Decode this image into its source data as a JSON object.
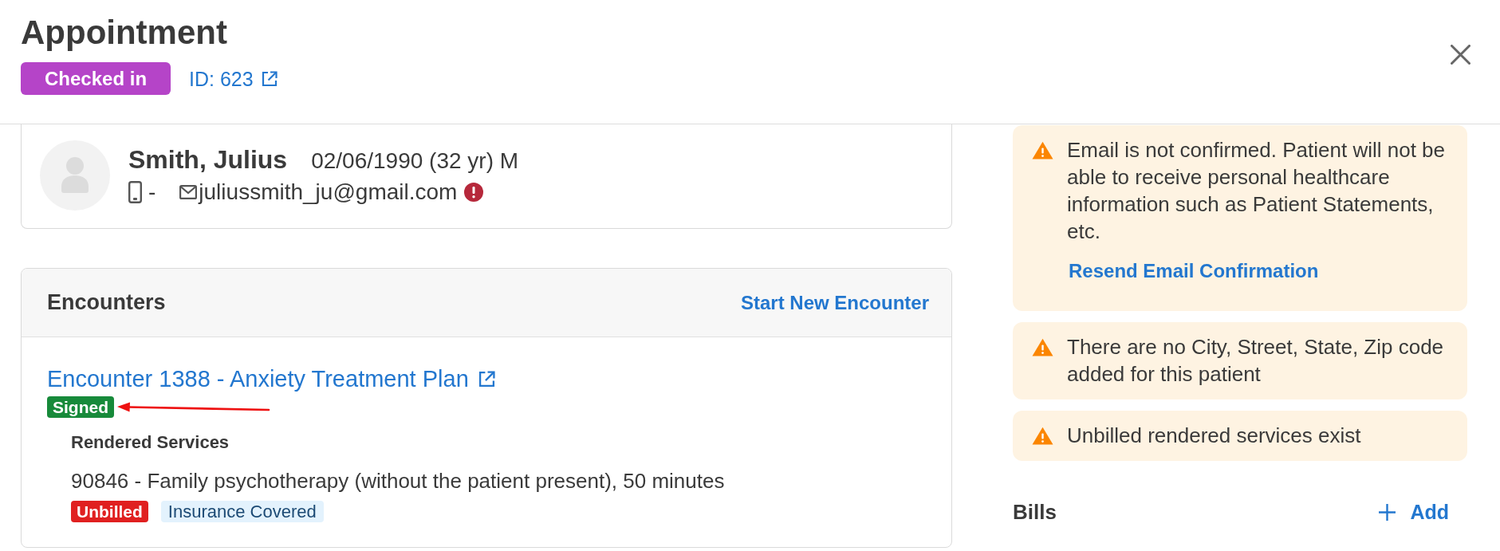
{
  "header": {
    "title": "Appointment",
    "status": "Checked in",
    "id_link": "ID: 623"
  },
  "patient": {
    "name": "Smith, Julius",
    "details": "02/06/1990 (32 yr) M",
    "phone": "-",
    "email": "juliussmith_ju@gmail.com",
    "email_confirmed": false
  },
  "encounters": {
    "title": "Encounters",
    "action": "Start New Encounter",
    "items": [
      {
        "title": "Encounter 1388 - Anxiety Treatment Plan",
        "status": "Signed",
        "services_heading": "Rendered Services",
        "services": [
          {
            "description": "90846 - Family psychotherapy (without the patient present), 50 minutes",
            "tags": [
              {
                "label": "Unbilled",
                "color": "#e02020"
              },
              {
                "label": "Insurance Covered",
                "color": "#e3f2fd"
              }
            ]
          }
        ]
      }
    ]
  },
  "alerts": [
    {
      "text": "Email is not confirmed. Patient will not be able to receive personal healthcare information such as Patient Statements, etc.",
      "action": "Resend Email Confirmation"
    },
    {
      "text": "There are no City, Street, State, Zip code added for this patient"
    },
    {
      "text": "Unbilled rendered services exist"
    }
  ],
  "bills": {
    "title": "Bills",
    "action": "Add"
  }
}
